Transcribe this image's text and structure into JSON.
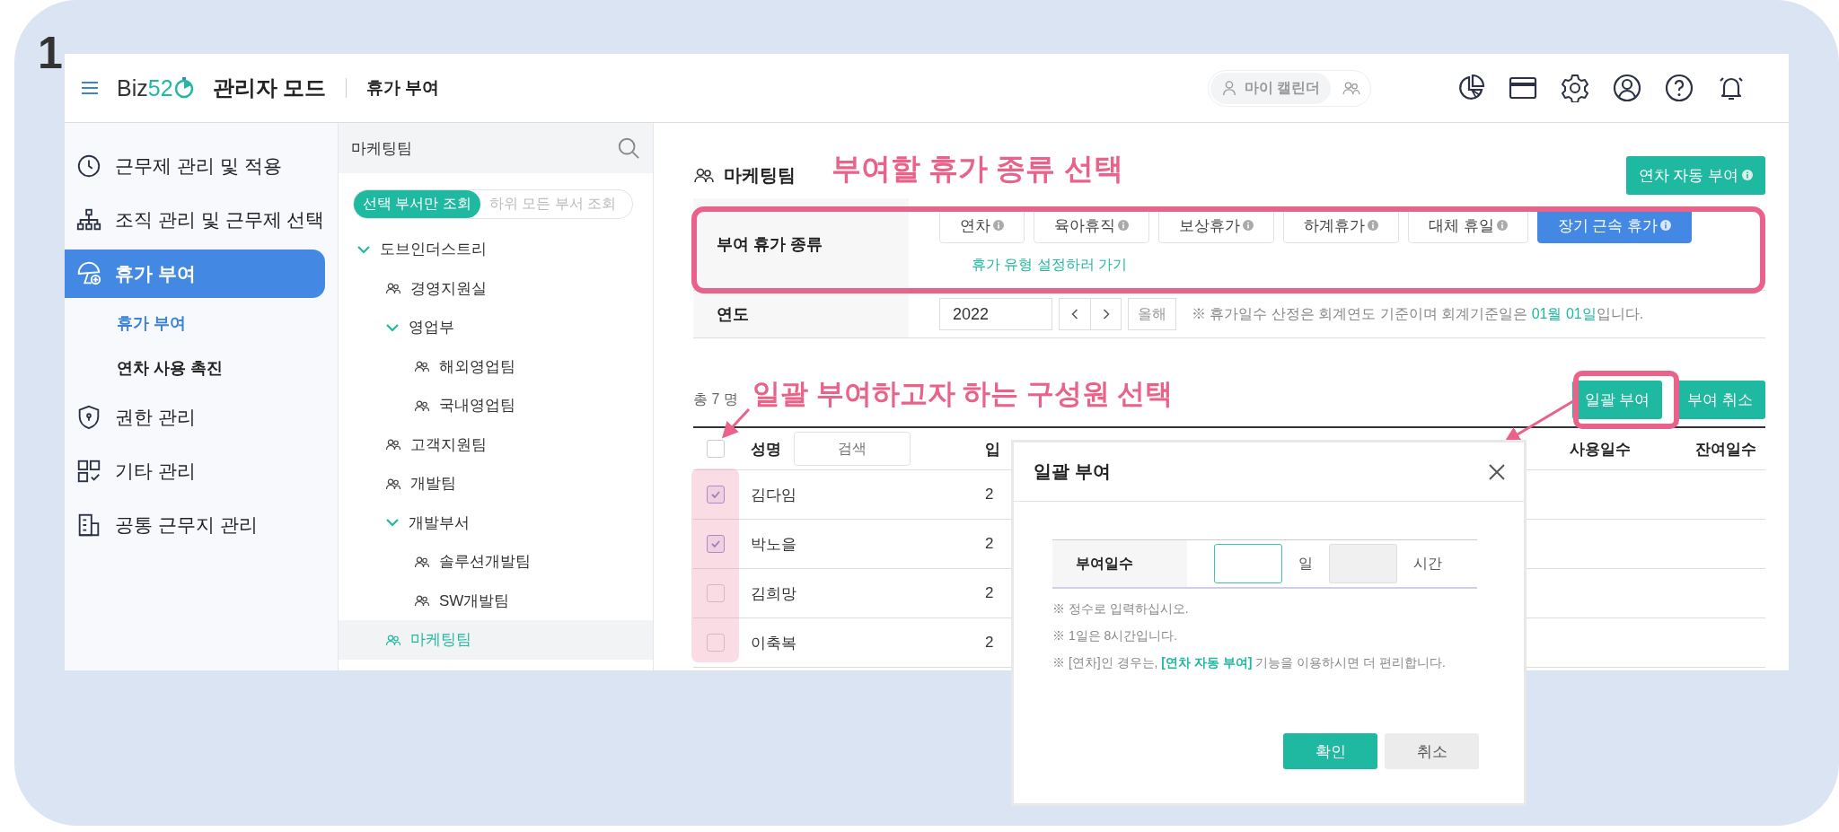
{
  "step": "1",
  "header": {
    "logo": {
      "text": "Biz",
      "accent": "52"
    },
    "mode": "관리자 모드",
    "page": "휴가 부여",
    "calendar_switch": [
      {
        "label": "마이 캘린더",
        "selected": true
      },
      {
        "selected": false
      }
    ]
  },
  "sidebar": {
    "items": [
      {
        "label": "근무제 관리 및 적용",
        "selected": false
      },
      {
        "label": "조직 관리 및 근무제 선택",
        "selected": false
      },
      {
        "label": "휴가 부여",
        "selected": true,
        "children": [
          {
            "label": "휴가 부여",
            "selected": true
          },
          {
            "label": "연차 사용 촉진",
            "selected": false
          }
        ]
      },
      {
        "label": "권한 관리",
        "selected": false
      },
      {
        "label": "기타 관리",
        "selected": false
      },
      {
        "label": "공통 근무지 관리",
        "selected": false
      }
    ]
  },
  "tree": {
    "search_value": "마케팅팀",
    "scope": [
      {
        "label": "선택 부서만 조회",
        "selected": true
      },
      {
        "label": "하위 모든 부서 조회",
        "selected": false
      }
    ],
    "items": [
      {
        "label": "도브인더스트리",
        "expanded": true,
        "selected": false,
        "children": [
          {
            "label": "경영지원실",
            "selected": false
          },
          {
            "label": "영업부",
            "expanded": true,
            "selected": false,
            "children": [
              {
                "label": "해외영업팀",
                "selected": false
              },
              {
                "label": "국내영업팀",
                "selected": false
              }
            ]
          },
          {
            "label": "고객지원팀",
            "selected": false
          },
          {
            "label": "개발팀",
            "selected": false
          },
          {
            "label": "개발부서",
            "expanded": true,
            "selected": false,
            "children": [
              {
                "label": "솔루션개발팀",
                "selected": false
              },
              {
                "label": "SW개발팀",
                "selected": false
              }
            ]
          },
          {
            "label": "마케팅팀",
            "selected": true
          }
        ]
      }
    ]
  },
  "main": {
    "title": "마케팅팀",
    "auto_grant_button": "연차 자동 부여",
    "leave_type": {
      "label": "부여 휴가 종류",
      "types": [
        {
          "label": "연차",
          "selected": false
        },
        {
          "label": "육아휴직",
          "selected": false
        },
        {
          "label": "보상휴가",
          "selected": false
        },
        {
          "label": "하계휴가",
          "selected": false
        },
        {
          "label": "대체 휴일",
          "selected": false
        },
        {
          "label": "장기 근속 휴가",
          "selected": true
        }
      ],
      "settings_link": "휴가 유형 설정하러 가기"
    },
    "year": {
      "label": "연도",
      "value": "2022",
      "this_year_button": "올해",
      "note": {
        "text": "※ 휴가일수 산정은 회계연도 기준이며 회계기준일은 ",
        "date": "01월 01일",
        "after": "입니다."
      }
    },
    "count": "총 7 명",
    "actions": [
      "일괄 부여",
      "부여 취소"
    ],
    "table": {
      "columns": [
        "성명",
        "입",
        "사용일수",
        "잔여일수"
      ],
      "name_search_placeholder": "검색",
      "all_checked": false,
      "rows": [
        {
          "checked": true,
          "name": "김다임",
          "column_2": "2"
        },
        {
          "checked": true,
          "name": "박노을",
          "column_2": "2"
        },
        {
          "checked": false,
          "name": "김희망",
          "column_2": "2"
        },
        {
          "checked": false,
          "name": "이축복",
          "column_2": "2"
        }
      ]
    }
  },
  "dialog": {
    "title": "일괄 부여",
    "field_label": "부여일수",
    "day_unit": "일",
    "hour_unit": "시간",
    "notes": [
      {
        "text": "※ 정수로 입력하십시오."
      },
      {
        "text": "※ 1일은 8시간입니다."
      },
      {
        "text": "※ [연차]인 경우는, ",
        "link": "[연차 자동 부여]",
        "after": " 기능을 이용하시면 더 편리합니다."
      }
    ],
    "confirm": "확인",
    "cancel": "취소"
  },
  "annotations": [
    {
      "text": "부여할 휴가 종류 선택"
    },
    {
      "text": "일괄 부여하고자 하는 구성원 선택"
    }
  ]
}
